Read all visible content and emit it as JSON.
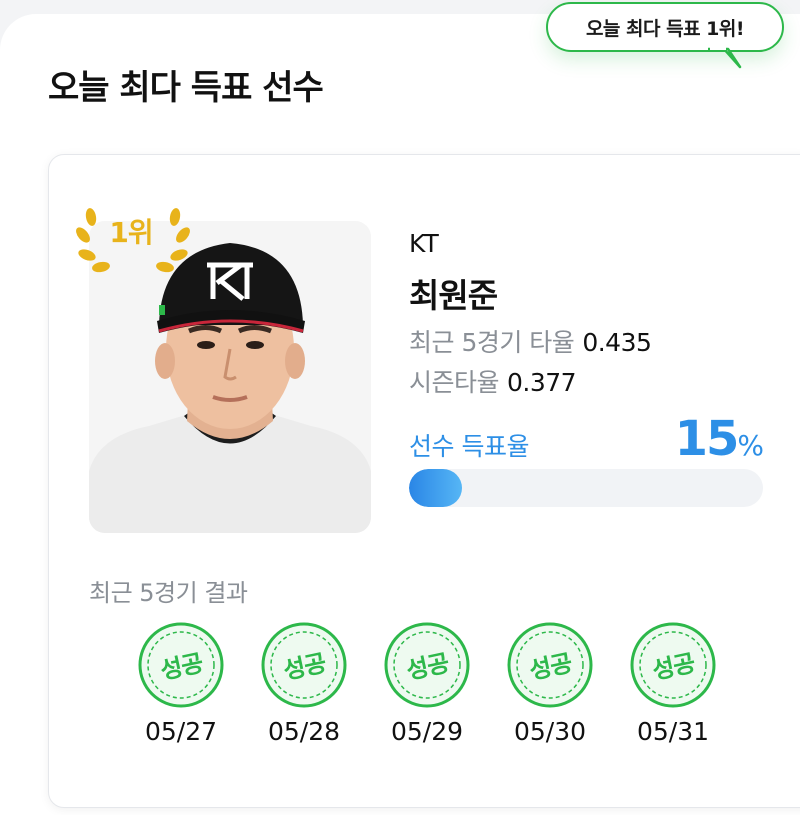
{
  "bubble": {
    "text": "오늘 최다 득표 1위!"
  },
  "page": {
    "title": "오늘 최다 득표 선수"
  },
  "player": {
    "rank_label": "1위",
    "team": "KT",
    "name": "최원준",
    "stats": [
      {
        "label": "최근 5경기 타율",
        "value": "0.435"
      },
      {
        "label": "시즌타율",
        "value": "0.377"
      }
    ],
    "vote": {
      "label": "선수 득표율",
      "percent_number": "15",
      "percent_unit": "%",
      "fraction": 0.15
    }
  },
  "recent": {
    "label": "최근 5경기 결과",
    "games": [
      {
        "result": "성공",
        "date": "05/27"
      },
      {
        "result": "성공",
        "date": "05/28"
      },
      {
        "result": "성공",
        "date": "05/29"
      },
      {
        "result": "성공",
        "date": "05/30"
      },
      {
        "result": "성공",
        "date": "05/31"
      }
    ]
  },
  "colors": {
    "accent_blue": "#2d8fe6",
    "success_green": "#2db84a",
    "rank_gold": "#e8b31b"
  }
}
